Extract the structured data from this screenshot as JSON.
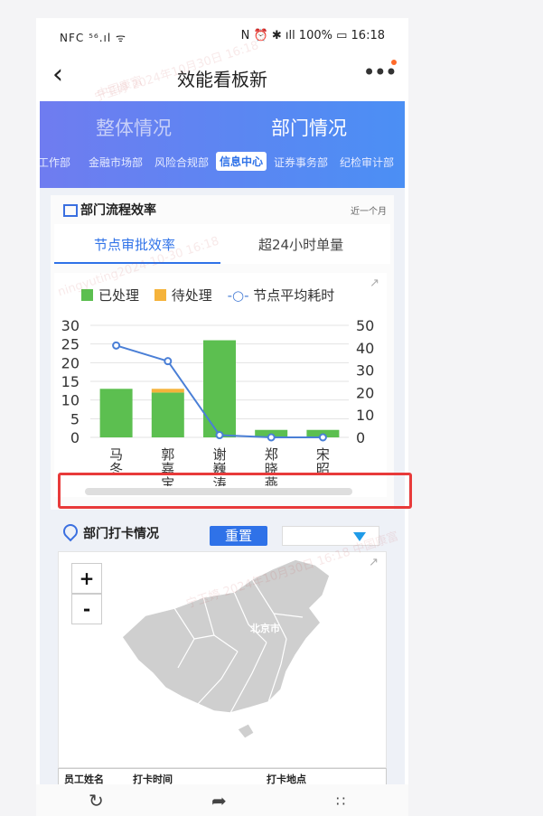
{
  "status_bar": {
    "left": "NFC ⁵⁶.ıl ᯤ",
    "right": "N ⏰ ✱ ıll 100% ▭ 16:18"
  },
  "nav": {
    "back_icon": "chevron-left-icon",
    "title": "效能看板新",
    "more_icon": "more-icon",
    "badge_color": "#ff6a2a"
  },
  "header": {
    "tab_overall": "整体情况",
    "tab_department": "部门情况",
    "departments": [
      "工作部",
      "金融市场部",
      "风险合规部",
      "信息中心",
      "证券事务部",
      "纪检审计部"
    ],
    "active_department": "信息中心"
  },
  "flow_card": {
    "title": "部门流程效率",
    "period": "近一个月",
    "tab_node": "节点审批效率",
    "tab_over24": "超24小时单量"
  },
  "chart_data": {
    "type": "bar",
    "categories": [
      "马冬",
      "郭嘉宝",
      "谢巍涛",
      "郑晓燕",
      "宋昭"
    ],
    "series": [
      {
        "name": "已处理",
        "type": "bar",
        "axis": "left",
        "stack": "s",
        "color": "#5cbf50",
        "values": [
          13,
          12,
          26,
          2,
          2
        ]
      },
      {
        "name": "待处理",
        "type": "bar",
        "axis": "left",
        "stack": "s",
        "color": "#f5b33b",
        "values": [
          0,
          1,
          0,
          0,
          0
        ]
      },
      {
        "name": "节点平均耗时",
        "type": "line",
        "axis": "right",
        "color": "#4a7fd6",
        "values": [
          41,
          34,
          1,
          0,
          0
        ]
      }
    ],
    "left_ticks": [
      "0",
      "5",
      "10",
      "15",
      "20",
      "25",
      "30"
    ],
    "right_ticks": [
      "0",
      "10",
      "20",
      "30",
      "40",
      "50"
    ],
    "ylim_left": [
      0,
      30
    ],
    "ylim_right": [
      0,
      50
    ],
    "grid": true,
    "legend_position": "top"
  },
  "checkin_card": {
    "title": "部门打卡情况",
    "reset_label": "重置",
    "select_value": "",
    "map_label": "北京市",
    "zoom_in": "+",
    "zoom_out": "-",
    "table_headers": [
      "员工姓名",
      "打卡时间",
      "打卡地点"
    ]
  },
  "bottom_bar": {
    "refresh_icon": "refresh-icon",
    "share_icon": "share-icon",
    "grid_icon": "grid-dots-icon"
  },
  "watermarks": [
    "宁玉婷 2024年10月30日 16:18",
    "中国康富",
    "ningyuting2024-10-30 16:18",
    "宁玉婷 2024年10月30日 16:18 中国康富"
  ]
}
